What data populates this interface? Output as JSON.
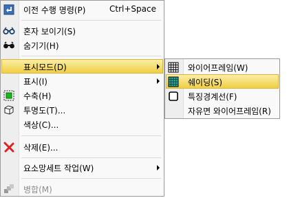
{
  "menu": {
    "items": [
      {
        "label": "이전 수행 명령(P)",
        "shortcut": "Ctrl+Space",
        "icon": "undo-icon"
      },
      {
        "label": "혼자 보이기(S)",
        "icon": "binoculars-icon"
      },
      {
        "label": "숨기기(H)",
        "icon": "binoculars-dark-icon"
      },
      {
        "label": "표시모드(D)",
        "icon": "",
        "submenu": true,
        "selected": true
      },
      {
        "label": "표시(I)",
        "icon": "",
        "submenu": true
      },
      {
        "label": "수축(H)",
        "icon": "shrink-icon"
      },
      {
        "label": "투명도(T)...",
        "icon": "cube-icon"
      },
      {
        "label": "색상(C)...",
        "icon": ""
      },
      {
        "label": "삭제(E)...",
        "icon": "delete-x-icon"
      },
      {
        "label": "요소망세트 작업(W)",
        "icon": "",
        "submenu": true
      },
      {
        "label": "병합(M)",
        "icon": "merge-icon",
        "disabled": true
      }
    ]
  },
  "submenu": {
    "items": [
      {
        "label": "와이어프레임(W)",
        "icon": "wireframe-grid-icon"
      },
      {
        "label": "쉐이딩(S)",
        "icon": "shaded-grid-icon"
      },
      {
        "label": "특징경계선(F)",
        "icon": "feature-edge-icon"
      },
      {
        "label": "자유면 와이어프레임(R)",
        "icon": ""
      }
    ]
  },
  "colors": {
    "highlight": "#f5e27a",
    "delete_icon": "#e02020",
    "shade_icon": "#2aa89a"
  }
}
